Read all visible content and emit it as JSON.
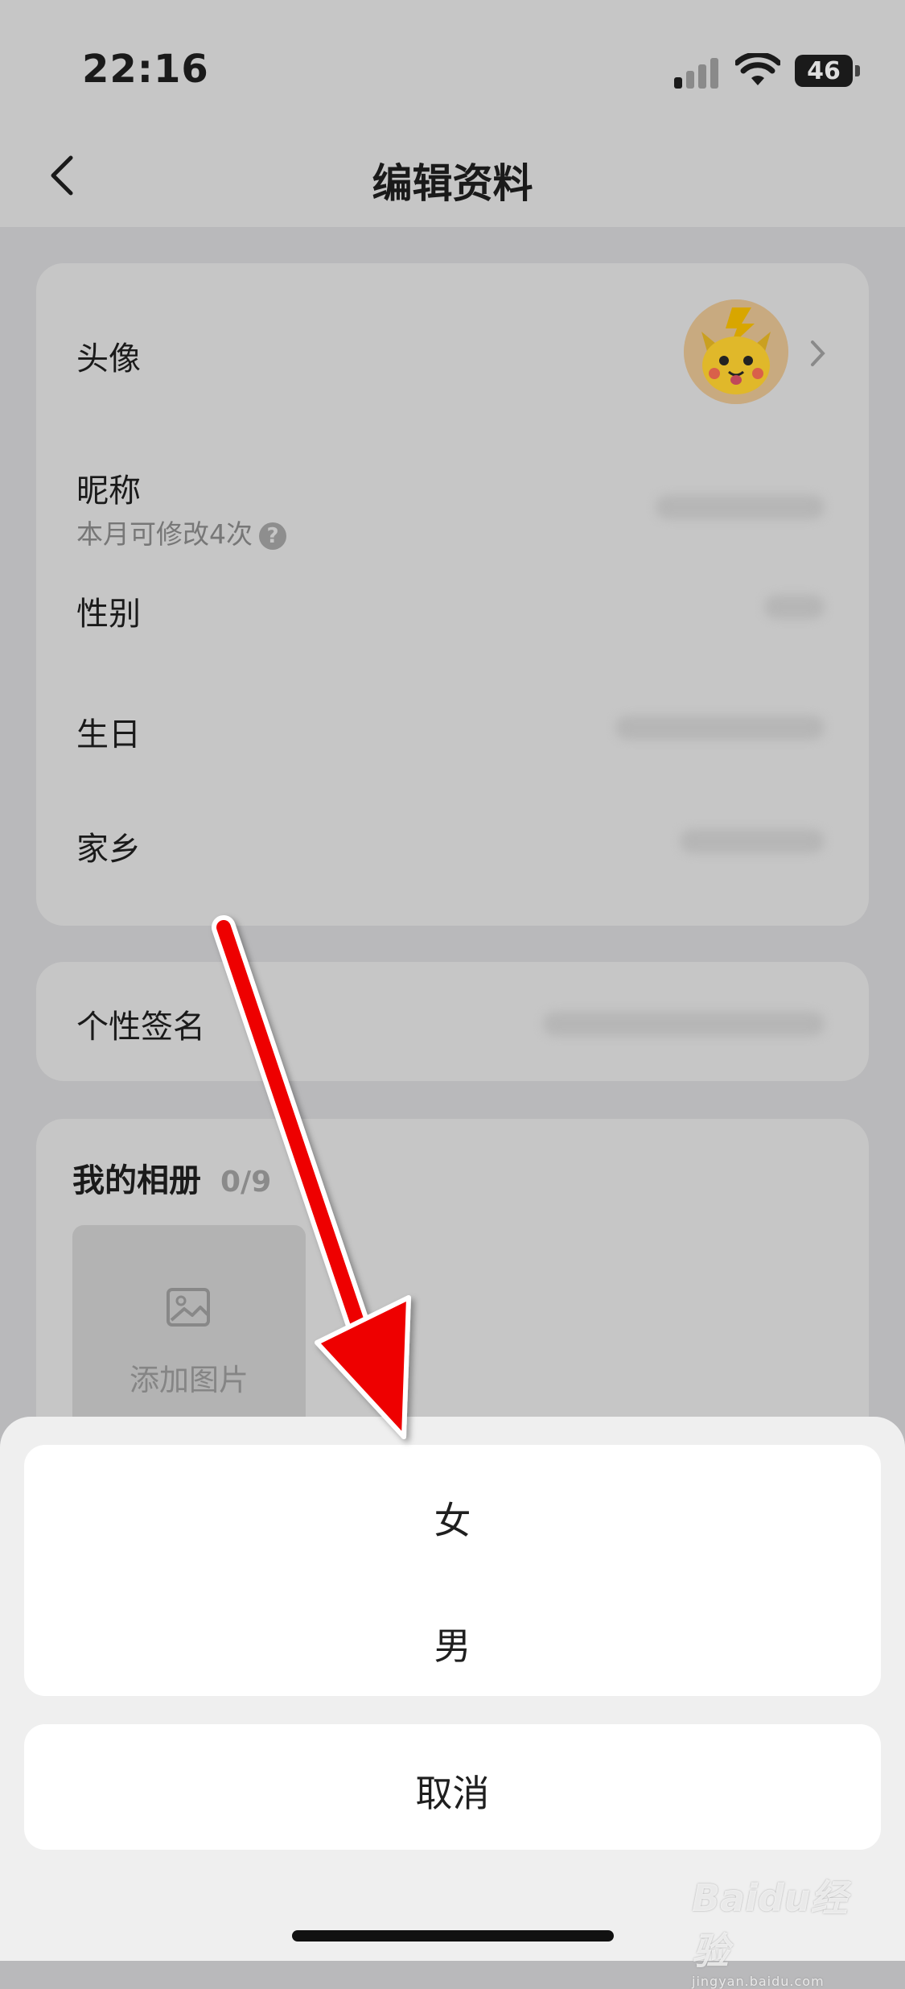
{
  "status_bar": {
    "time": "22:16",
    "battery": "46"
  },
  "header": {
    "title": "编辑资料"
  },
  "profile": {
    "avatar_label": "头像",
    "nickname_label": "昵称",
    "nickname_hint": "本月可修改4次",
    "help_mark": "?",
    "gender_label": "性别",
    "birthday_label": "生日",
    "hometown_label": "家乡"
  },
  "signature": {
    "label": "个性签名"
  },
  "album": {
    "label": "我的相册",
    "count": "0/9",
    "add_label": "添加图片"
  },
  "action_sheet": {
    "options": [
      "女",
      "男"
    ],
    "cancel": "取消"
  },
  "watermark": {
    "brand": "Baidu经验",
    "url": "jingyan.baidu.com"
  },
  "colors": {
    "annotation_arrow": "#ff0000",
    "overlay": "#b9b9bb"
  }
}
